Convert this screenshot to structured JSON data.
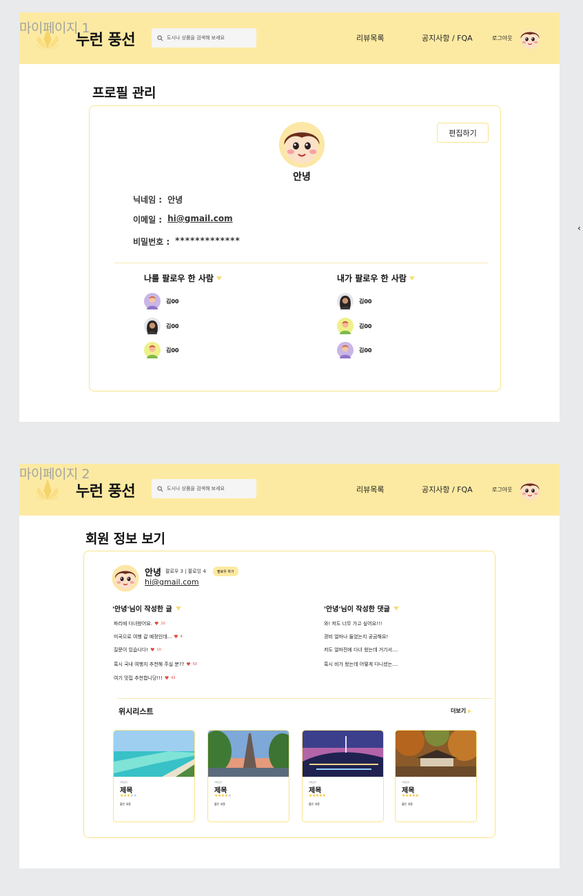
{
  "frames": [
    {
      "label": "마이페이지 1",
      "header": {
        "brand": "누런 풍선",
        "search_placeholder": "도시나 상품을 검색해 보세요",
        "nav": {
          "review": "리뷰목록",
          "notice": "공지사항 / FQA",
          "logout": "로그아웃"
        }
      },
      "section_title": "프로필 관리",
      "edit_label": "편집하기",
      "profile_name": "안녕",
      "info": {
        "nickname_label": "닉네임 :",
        "nickname": "안녕",
        "email_label": "이메일 :",
        "email": "hi@gmail.com",
        "password_label": "비밀번호 :",
        "password": "*************"
      },
      "followers": {
        "title": "나를 팔로우 한 사람",
        "people": [
          {
            "name": "김00",
            "avatar": "purple-woman-avatar-icon"
          },
          {
            "name": "김00",
            "avatar": "dark-hair-woman-avatar-icon"
          },
          {
            "name": "김00",
            "avatar": "yellow-man-avatar-icon"
          }
        ]
      },
      "following": {
        "title": "내가 팔로우 한 사람",
        "people": [
          {
            "name": "김00",
            "avatar": "dark-hair-woman-avatar-icon"
          },
          {
            "name": "김00",
            "avatar": "yellow-man-avatar-icon"
          },
          {
            "name": "김00",
            "avatar": "purple-woman-avatar-icon"
          }
        ]
      }
    },
    {
      "label": "마이페이지 2",
      "header": {
        "brand": "누런 풍선",
        "search_placeholder": "도시나 상품을 검색해 보세요",
        "nav": {
          "review": "리뷰목록",
          "notice": "공지사항 / FQA",
          "logout": "로그아웃"
        }
      },
      "section_title": "회원 정보 보기",
      "user": {
        "name": "안녕",
        "stats": "팔로우 3 | 팔로잉 4",
        "follow_btn": "팔로우 하기",
        "email": "hi@gmail.com"
      },
      "posts": {
        "title": "'안녕'님이 작성한 글",
        "items": [
          {
            "text": "파리에 다녀왔어요.",
            "likes": "20"
          },
          {
            "text": "미국으로 여행 갈 예정인데...",
            "likes": "4"
          },
          {
            "text": "질문이 있습니다!",
            "likes": "10"
          },
          {
            "text": "혹시 국내 여행지 추천해 주실 분??",
            "likes": "50"
          },
          {
            "text": "여기 맛집 추천합니당!!!",
            "likes": "43"
          }
        ]
      },
      "comments": {
        "title": "'안녕'님이 작성한 댓글",
        "items": [
          "와! 저도 너무 가고 싶어요!!!",
          "경비 얼마나 들었는지 궁금해요!",
          "저도 얼마전에 다녀 왔는데 거기서....",
          "혹시 비가 왔는데 어떻게 다니셨는...."
        ]
      },
      "wishlist": {
        "title": "위시리스트",
        "more": "더보기",
        "cards": [
          {
            "category": "카테고리",
            "title": "제목",
            "rating": 3,
            "desc": "짧은 내용",
            "photo": "beach"
          },
          {
            "category": "카테고리",
            "title": "제목",
            "rating": 4,
            "desc": "짧은 내용",
            "photo": "eiffel"
          },
          {
            "category": "카테고리",
            "title": "제목",
            "rating": 5,
            "desc": "짧은 내용",
            "photo": "seoul-night"
          },
          {
            "category": "카테고리",
            "title": "제목",
            "rating": 5,
            "desc": "짧은 내용",
            "photo": "autumn-temple"
          }
        ]
      }
    }
  ],
  "colors": {
    "accent": "#fdeaa2",
    "border": "#f9e38a",
    "heart": "#e0473c",
    "star": "#f2c230"
  }
}
